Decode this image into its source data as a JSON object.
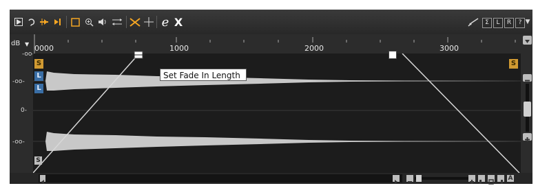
{
  "toolbar": {
    "left_icons": [
      "play-icon",
      "loop-icon",
      "play-from-cursor-icon",
      "play-selection-icon",
      "selection-tool-icon",
      "zoom-tool-icon",
      "speaker-icon",
      "move-tool-icon",
      "crossfade-icon",
      "cursor-crosshair-icon",
      "e-icon",
      "x-icon"
    ],
    "right_icons": [
      "draw-tool-icon"
    ],
    "sigma_label": "Σ",
    "l_label": "L",
    "r_label": "R",
    "channel_label": "?"
  },
  "ruler": {
    "db_label": "dB",
    "ticks": [
      "0000",
      "1000",
      "2000",
      "3000"
    ]
  },
  "yaxis": {
    "labels": [
      "-oo-",
      "-oo-",
      "0-",
      "-oo-"
    ]
  },
  "tags": {
    "s_top": "S",
    "l1": "L",
    "l2": "L",
    "s_right": "S",
    "s_bottom": "S"
  },
  "tooltip": "Set Fade In Length",
  "colors": {
    "background": "#2c2c2c",
    "wave_bg": "#1c1c1c",
    "waveform": "#c8c8c8",
    "accent_orange": "#f5a623",
    "tag_gold": "#d19a32",
    "tag_blue": "#3a6ea5"
  }
}
